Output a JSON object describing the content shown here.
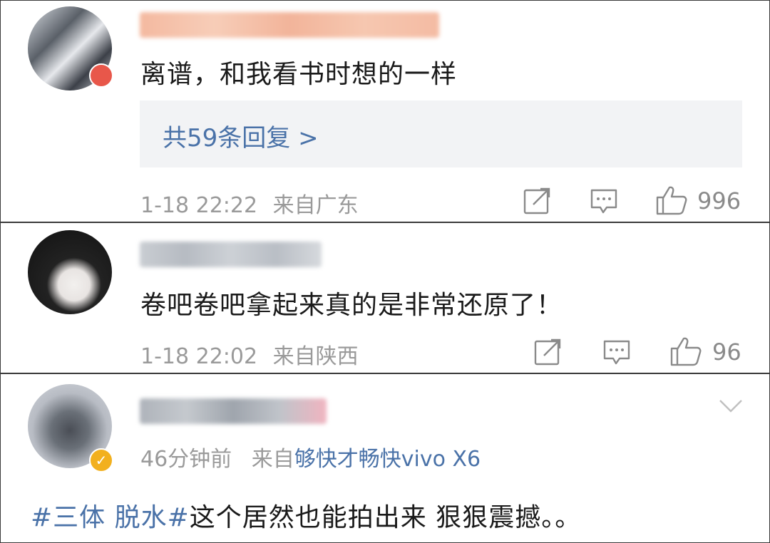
{
  "colors": {
    "link": "#4a72a8",
    "meta": "#9a9a9a",
    "text": "#1a1a1a",
    "reply_bg": "#f2f3f5",
    "badge_red": "#e8574a",
    "badge_gold": "#f2b01e"
  },
  "comments": [
    {
      "text": "离谱，和我看书时想的一样",
      "reply_label": "共59条回复 >",
      "time": "1-18 22:22",
      "location": "来自广东",
      "likes": "996"
    },
    {
      "text": "卷吧卷吧拿起来真的是非常还原了！",
      "time": "1-18 22:02",
      "location": "来自陕西",
      "likes": "96"
    },
    {
      "time": "46分钟前",
      "source_prefix": "来自",
      "source": "够快才畅快vivo X6",
      "hashtag": "#三体 脱水#",
      "text": "这个居然也能拍出来 狠狠震撼。。"
    }
  ]
}
